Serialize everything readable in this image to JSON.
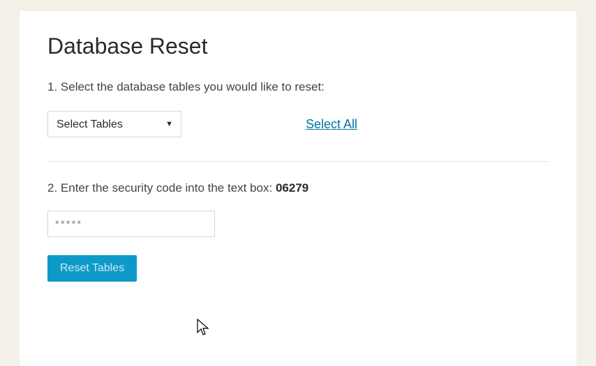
{
  "page": {
    "title": "Database Reset"
  },
  "step1": {
    "label": "1. Select the database tables you would like to reset:",
    "select_placeholder": "Select Tables",
    "select_all_label": "Select All"
  },
  "step2": {
    "label_prefix": "2. Enter the security code into the text box:  ",
    "security_code": "06279",
    "input_value": "*****"
  },
  "actions": {
    "reset_label": "Reset Tables"
  }
}
